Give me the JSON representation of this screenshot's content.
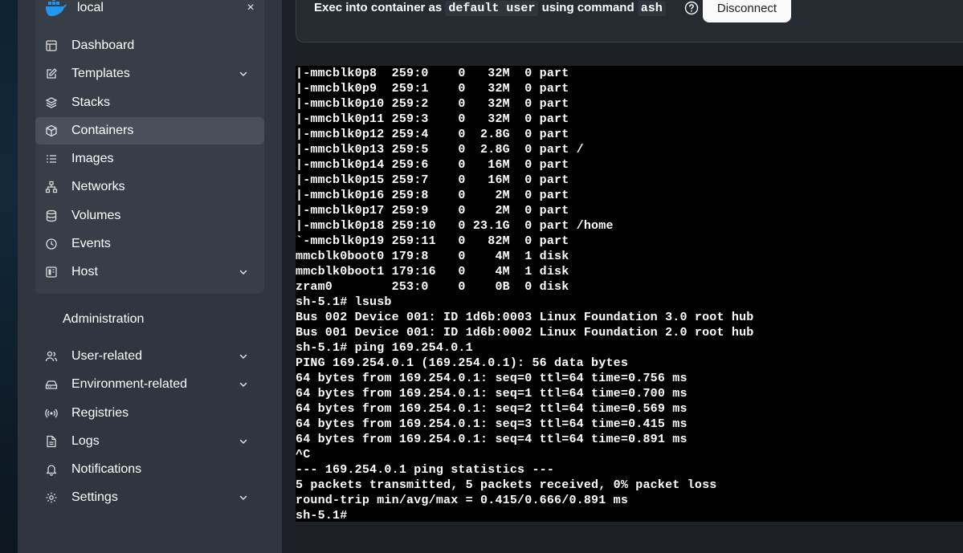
{
  "environment": {
    "name": "local",
    "close_glyph": "×",
    "logo_icon": "docker-whale-icon",
    "logo_color": "#2496ed"
  },
  "nav": {
    "items": [
      {
        "label": "Dashboard",
        "icon": "dashboard-icon"
      },
      {
        "label": "Templates",
        "icon": "edit-icon",
        "expandable": true
      },
      {
        "label": "Stacks",
        "icon": "layers-icon"
      },
      {
        "label": "Containers",
        "icon": "box-icon",
        "active": true
      },
      {
        "label": "Images",
        "icon": "list-icon"
      },
      {
        "label": "Networks",
        "icon": "network-icon"
      },
      {
        "label": "Volumes",
        "icon": "database-icon"
      },
      {
        "label": "Events",
        "icon": "clock-icon"
      },
      {
        "label": "Host",
        "icon": "host-icon",
        "expandable": true
      }
    ]
  },
  "admin": {
    "title": "Administration",
    "items": [
      {
        "label": "User-related",
        "icon": "users-icon",
        "expandable": true
      },
      {
        "label": "Environment-related",
        "icon": "hard-drive-icon",
        "expandable": true
      },
      {
        "label": "Registries",
        "icon": "radio-icon"
      },
      {
        "label": "Logs",
        "icon": "file-text-icon",
        "expandable": true
      },
      {
        "label": "Notifications",
        "icon": "bell-icon"
      },
      {
        "label": "Settings",
        "icon": "gear-icon",
        "expandable": true
      }
    ]
  },
  "exec": {
    "prefix": "Exec into container as",
    "user": "default user",
    "middle": "using command",
    "command": "ash",
    "disconnect_label": "Disconnect"
  },
  "terminal": {
    "lines": [
      "|-mmcblk0p8  259:0    0   32M  0 part",
      "|-mmcblk0p9  259:1    0   32M  0 part",
      "|-mmcblk0p10 259:2    0   32M  0 part",
      "|-mmcblk0p11 259:3    0   32M  0 part",
      "|-mmcblk0p12 259:4    0  2.8G  0 part",
      "|-mmcblk0p13 259:5    0  2.8G  0 part /",
      "|-mmcblk0p14 259:6    0   16M  0 part",
      "|-mmcblk0p15 259:7    0   16M  0 part",
      "|-mmcblk0p16 259:8    0    2M  0 part",
      "|-mmcblk0p17 259:9    0    2M  0 part",
      "|-mmcblk0p18 259:10   0 23.1G  0 part /home",
      "`-mmcblk0p19 259:11   0   82M  0 part",
      "mmcblk0boot0 179:8    0    4M  1 disk",
      "mmcblk0boot1 179:16   0    4M  1 disk",
      "zram0        253:0    0    0B  0 disk",
      "sh-5.1# lsusb",
      "Bus 002 Device 001: ID 1d6b:0003 Linux Foundation 3.0 root hub",
      "Bus 001 Device 001: ID 1d6b:0002 Linux Foundation 2.0 root hub",
      "sh-5.1# ping 169.254.0.1",
      "PING 169.254.0.1 (169.254.0.1): 56 data bytes",
      "64 bytes from 169.254.0.1: seq=0 ttl=64 time=0.756 ms",
      "64 bytes from 169.254.0.1: seq=1 ttl=64 time=0.700 ms",
      "64 bytes from 169.254.0.1: seq=2 ttl=64 time=0.569 ms",
      "64 bytes from 169.254.0.1: seq=3 ttl=64 time=0.415 ms",
      "64 bytes from 169.254.0.1: seq=4 ttl=64 time=0.891 ms",
      "^C",
      "--- 169.254.0.1 ping statistics ---",
      "5 packets transmitted, 5 packets received, 0% packet loss",
      "round-trip min/avg/max = 0.415/0.666/0.891 ms",
      "sh-5.1#"
    ]
  }
}
